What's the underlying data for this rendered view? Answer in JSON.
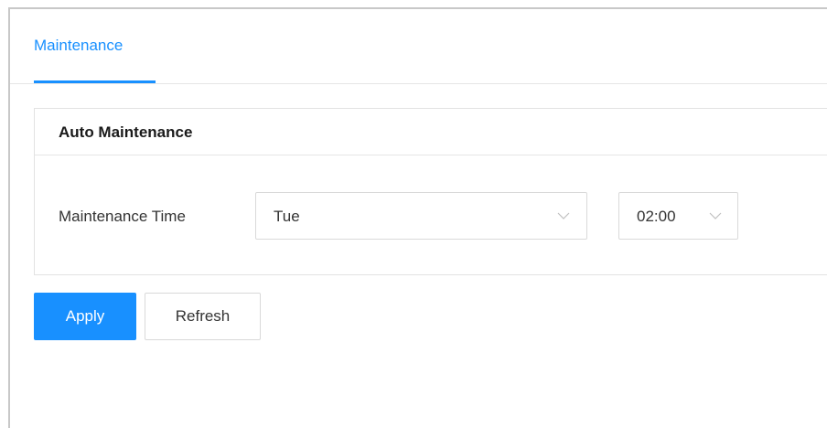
{
  "tabs": [
    {
      "label": "Maintenance",
      "active": true
    }
  ],
  "auto_maintenance": {
    "title": "Auto Maintenance",
    "maintenance_time_label": "Maintenance Time",
    "day_select": {
      "value": "Tue"
    },
    "time_select": {
      "value": "02:00"
    }
  },
  "actions": {
    "apply_label": "Apply",
    "refresh_label": "Refresh"
  },
  "colors": {
    "accent": "#1890ff",
    "border": "#d9d9d9",
    "text": "#333333"
  },
  "icons": {
    "dropdown": "chevron-down-icon"
  }
}
